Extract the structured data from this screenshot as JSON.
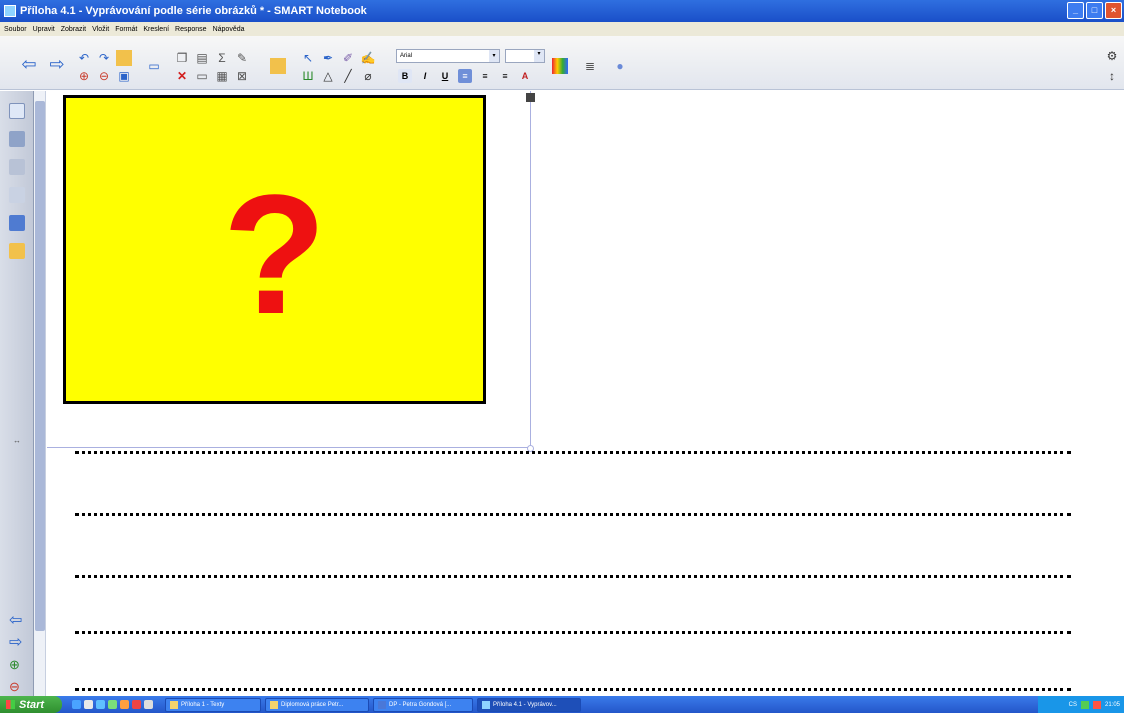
{
  "window": {
    "title": "Příloha 4.1 - Vyprávování podle série obrázků * - SMART Notebook",
    "buttons": [
      "minimize",
      "maximize",
      "close"
    ]
  },
  "menu": {
    "items": [
      "Soubor",
      "Upravit",
      "Zobrazit",
      "Vložit",
      "Formát",
      "Kreslení",
      "Response",
      "Nápověda"
    ]
  },
  "toolbar": {
    "font_name": "Arial",
    "font_size": "",
    "format_buttons": [
      "B",
      "I",
      "U"
    ]
  },
  "canvas": {
    "card_symbol": "?",
    "card_color": "#ffff00",
    "symbol_color": "#ee1111",
    "dotted_line_count": 5
  },
  "sidebar": {
    "icons": [
      "page-sorter-icon",
      "gallery-icon",
      "attachments-icon",
      "properties-icon",
      "addons-icon",
      "response-icon"
    ],
    "nav": [
      "back-arrow-icon",
      "forward-arrow-icon",
      "add-page-icon",
      "delete-page-icon"
    ]
  },
  "taskbar": {
    "start_label": "Start",
    "tasks": [
      {
        "label": "Příloha 1 - Texty",
        "active": false
      },
      {
        "label": "Diplomová práce Petr...",
        "active": false
      },
      {
        "label": "DP - Petra Gondová [...",
        "active": false
      },
      {
        "label": "Příloha 4.1 - Vyprávov...",
        "active": true
      }
    ],
    "tray_lang": "CS",
    "tray_time": "21:05"
  }
}
